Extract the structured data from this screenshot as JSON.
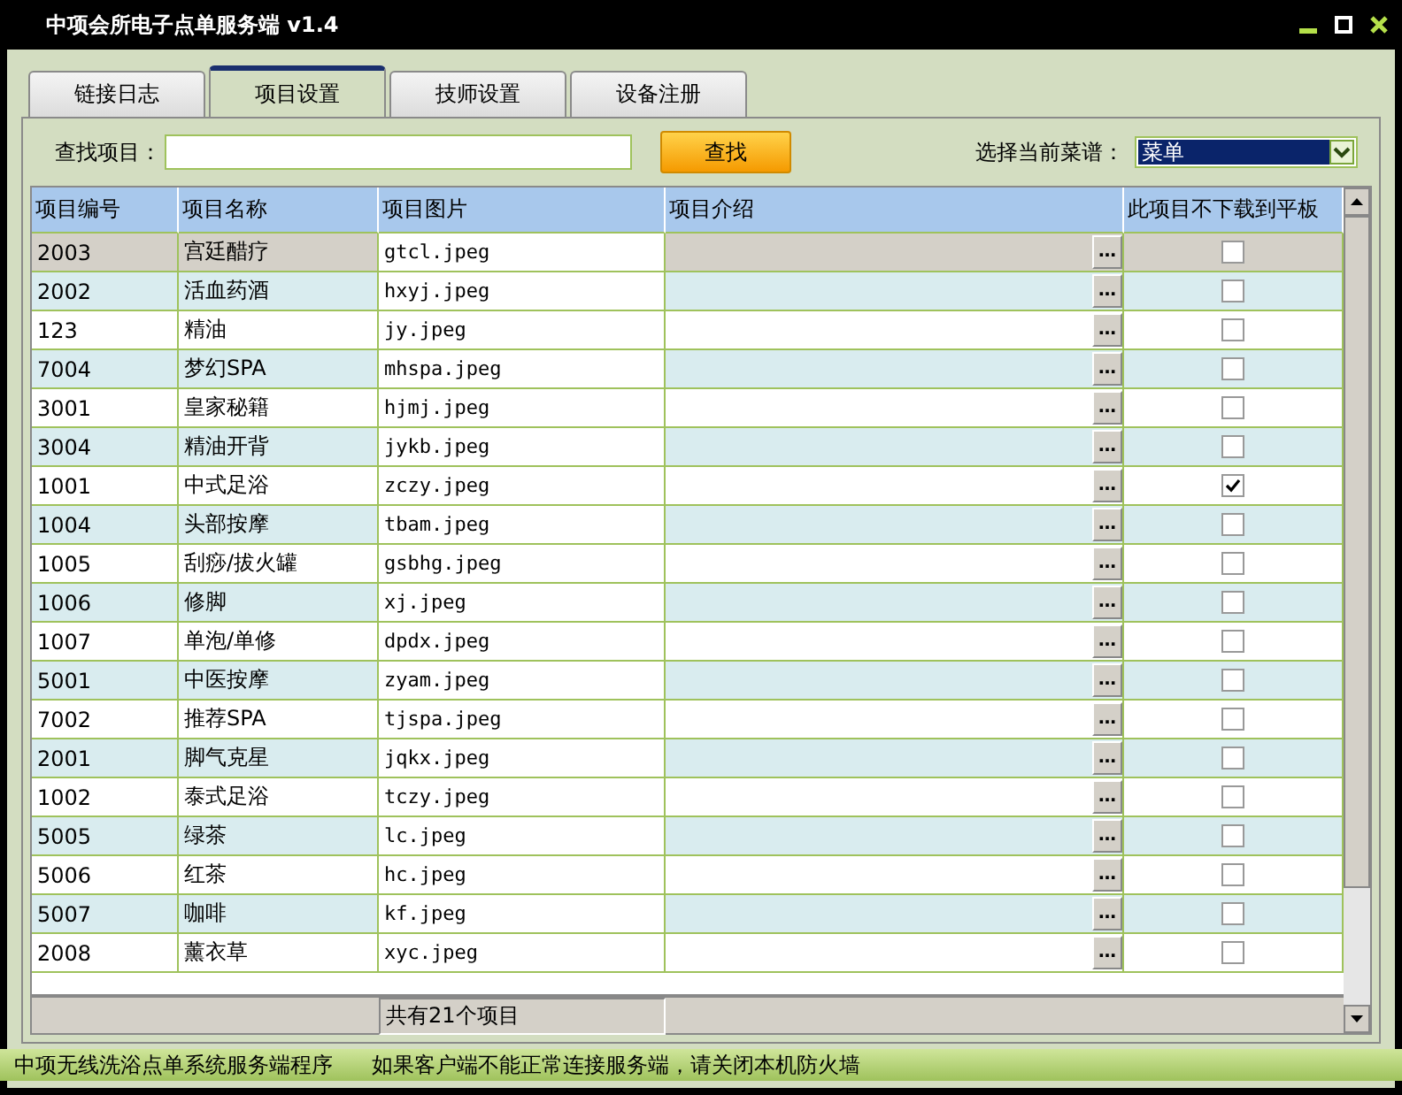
{
  "window": {
    "title": "中项会所电子点单服务端 v1.4"
  },
  "tabs": [
    {
      "label": "链接日志",
      "selected": false
    },
    {
      "label": "项目设置",
      "selected": true
    },
    {
      "label": "技师设置",
      "selected": false
    },
    {
      "label": "设备注册",
      "selected": false
    }
  ],
  "search": {
    "label": "查找项目：",
    "button": "查找"
  },
  "menu_select": {
    "label": "选择当前菜谱：",
    "value": "菜单"
  },
  "table": {
    "columns": [
      "项目编号",
      "项目名称",
      "项目图片",
      "项目介绍",
      "此项目不下载到平板"
    ],
    "browse_button": "…",
    "rows": [
      {
        "code": "2003",
        "name": "宫廷醋疗",
        "image": "gtcl.jpeg",
        "no_download": false,
        "selected": true
      },
      {
        "code": "2002",
        "name": "活血药酒",
        "image": "hxyj.jpeg",
        "no_download": false,
        "selected": false
      },
      {
        "code": "123",
        "name": "精油",
        "image": "jy.jpeg",
        "no_download": false,
        "selected": false
      },
      {
        "code": "7004",
        "name": "梦幻SPA",
        "image": "mhspa.jpeg",
        "no_download": false,
        "selected": false
      },
      {
        "code": "3001",
        "name": "皇家秘籍",
        "image": "hjmj.jpeg",
        "no_download": false,
        "selected": false
      },
      {
        "code": "3004",
        "name": "精油开背",
        "image": "jykb.jpeg",
        "no_download": false,
        "selected": false
      },
      {
        "code": "1001",
        "name": "中式足浴",
        "image": "zczy.jpeg",
        "no_download": true,
        "selected": false
      },
      {
        "code": "1004",
        "name": "头部按摩",
        "image": "tbam.jpeg",
        "no_download": false,
        "selected": false
      },
      {
        "code": "1005",
        "name": "刮痧/拔火罐",
        "image": "gsbhg.jpeg",
        "no_download": false,
        "selected": false
      },
      {
        "code": "1006",
        "name": "修脚",
        "image": "xj.jpeg",
        "no_download": false,
        "selected": false
      },
      {
        "code": "1007",
        "name": "单泡/单修",
        "image": "dpdx.jpeg",
        "no_download": false,
        "selected": false
      },
      {
        "code": "5001",
        "name": "中医按摩",
        "image": "zyam.jpeg",
        "no_download": false,
        "selected": false
      },
      {
        "code": "7002",
        "name": "推荐SPA",
        "image": "tjspa.jpeg",
        "no_download": false,
        "selected": false
      },
      {
        "code": "2001",
        "name": "脚气克星",
        "image": "jqkx.jpeg",
        "no_download": false,
        "selected": false
      },
      {
        "code": "1002",
        "name": "泰式足浴",
        "image": "tczy.jpeg",
        "no_download": false,
        "selected": false
      },
      {
        "code": "5005",
        "name": "绿茶",
        "image": "lc.jpeg",
        "no_download": false,
        "selected": false
      },
      {
        "code": "5006",
        "name": "红茶",
        "image": "hc.jpeg",
        "no_download": false,
        "selected": false
      },
      {
        "code": "5007",
        "name": "咖啡",
        "image": "kf.jpeg",
        "no_download": false,
        "selected": false
      },
      {
        "code": "2008",
        "name": "薰衣草",
        "image": "xyc.jpeg",
        "no_download": false,
        "selected": false
      }
    ],
    "footer": "共有21个项目"
  },
  "status_bar": [
    "中项无线洗浴点单系统服务端程序",
    "如果客户端不能正常连接服务端，请关闭本机防火墙"
  ]
}
